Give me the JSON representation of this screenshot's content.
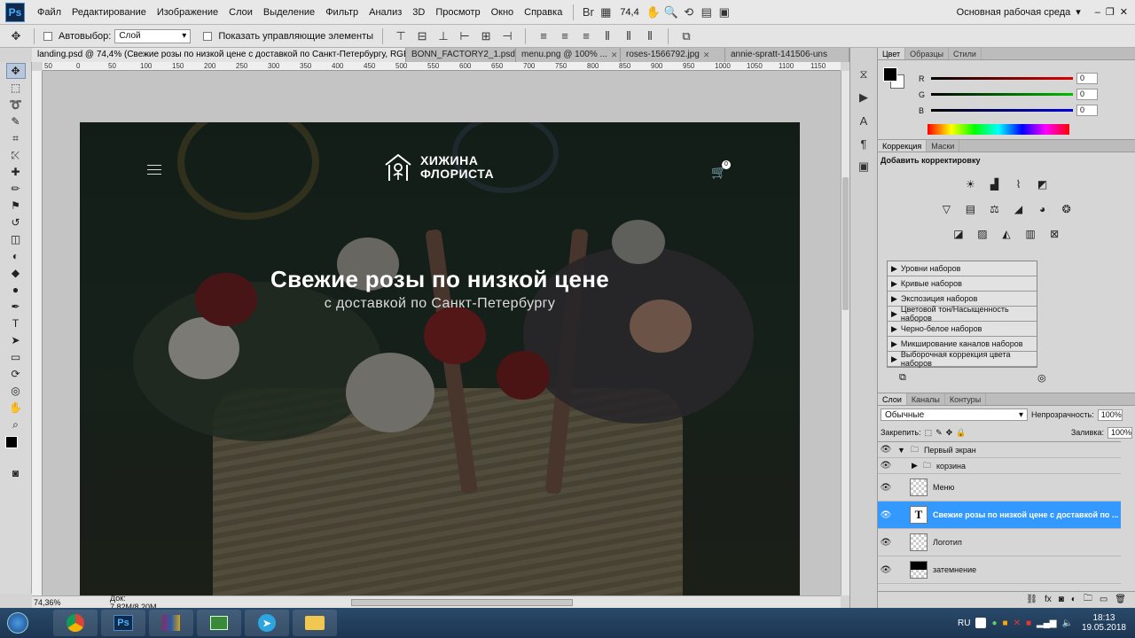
{
  "app": {
    "logo": "Ps"
  },
  "menu": [
    "Файл",
    "Редактирование",
    "Изображение",
    "Слои",
    "Выделение",
    "Фильтр",
    "Анализ",
    "3D",
    "Просмотр",
    "Окно",
    "Справка"
  ],
  "toolbar": {
    "zoom": "74,4",
    "workspace": "Основная рабочая среда"
  },
  "options": {
    "autoselect_label": "Автовыбор:",
    "autoselect_value": "Слой",
    "show_controls_label": "Показать управляющие элементы"
  },
  "tabs": [
    {
      "label": "landing.psd @ 74,4% (Свежие розы по низкой цене с доставкой по Санкт-Петербургу, RGB/8)",
      "active": true
    },
    {
      "label": "BONN_FACTORY2_1.psd",
      "active": false
    },
    {
      "label": "menu.png @ 100% ...",
      "active": false
    },
    {
      "label": "roses-1566792.jpg",
      "active": false
    },
    {
      "label": "annie-spratt-141506-uns",
      "active": false
    }
  ],
  "ruler_ticks": [
    "50",
    "0",
    "50",
    "100",
    "150",
    "200",
    "250",
    "300",
    "350",
    "400",
    "450",
    "500",
    "550",
    "600",
    "650",
    "700",
    "750",
    "800",
    "850",
    "900",
    "950",
    "1000",
    "1050",
    "1100",
    "1150"
  ],
  "artboard": {
    "logo_line1": "ХИЖИНА",
    "logo_line2": "ФЛОРИСТА",
    "cart_count": "0",
    "headline": "Свежие розы по низкой цене",
    "subheadline": "с доставкой по Санкт-Петербургу"
  },
  "status": {
    "zoom": "74,36%",
    "doc": "Док: 7,82M/8,20M"
  },
  "color_panel": {
    "tabs": [
      "Цвет",
      "Образцы",
      "Стили"
    ],
    "channels": [
      {
        "label": "R",
        "value": "0",
        "color": "#e00000"
      },
      {
        "label": "G",
        "value": "0",
        "color": "#00c000"
      },
      {
        "label": "B",
        "value": "0",
        "color": "#0000e0"
      }
    ]
  },
  "adjust_panel": {
    "tabs": [
      "Коррекция",
      "Маски"
    ],
    "title": "Добавить корректировку",
    "presets": [
      "Уровни наборов",
      "Кривые наборов",
      "Экспозиция наборов",
      "Цветовой тон/Насыщенность наборов",
      "Черно-белое наборов",
      "Микширование каналов наборов",
      "Выборочная коррекция цвета наборов"
    ]
  },
  "layers_panel": {
    "tabs": [
      "Слои",
      "Каналы",
      "Контуры"
    ],
    "blend": "Обычные",
    "opacity_label": "Непрозрачность:",
    "opacity": "100%",
    "lock_label": "Закрепить:",
    "fill_label": "Заливка:",
    "fill": "100%",
    "layers": [
      {
        "name": "Первый экран",
        "type": "group",
        "indent": 0,
        "selected": false
      },
      {
        "name": "корзина",
        "type": "group",
        "indent": 1,
        "selected": false
      },
      {
        "name": "Меню",
        "type": "pixel",
        "indent": 1,
        "selected": false
      },
      {
        "name": "Свежие розы по низкой цене с доставкой по ...",
        "type": "text",
        "indent": 1,
        "selected": true
      },
      {
        "name": "Логотип",
        "type": "pixel",
        "indent": 1,
        "selected": false
      },
      {
        "name": "затемнение",
        "type": "fill",
        "indent": 1,
        "selected": false
      }
    ]
  },
  "taskbar": {
    "lang": "RU",
    "time": "18:13",
    "date": "19.05.2018"
  },
  "colors": {
    "accent": "#3399ff",
    "selected_layer": "#3399ff"
  }
}
